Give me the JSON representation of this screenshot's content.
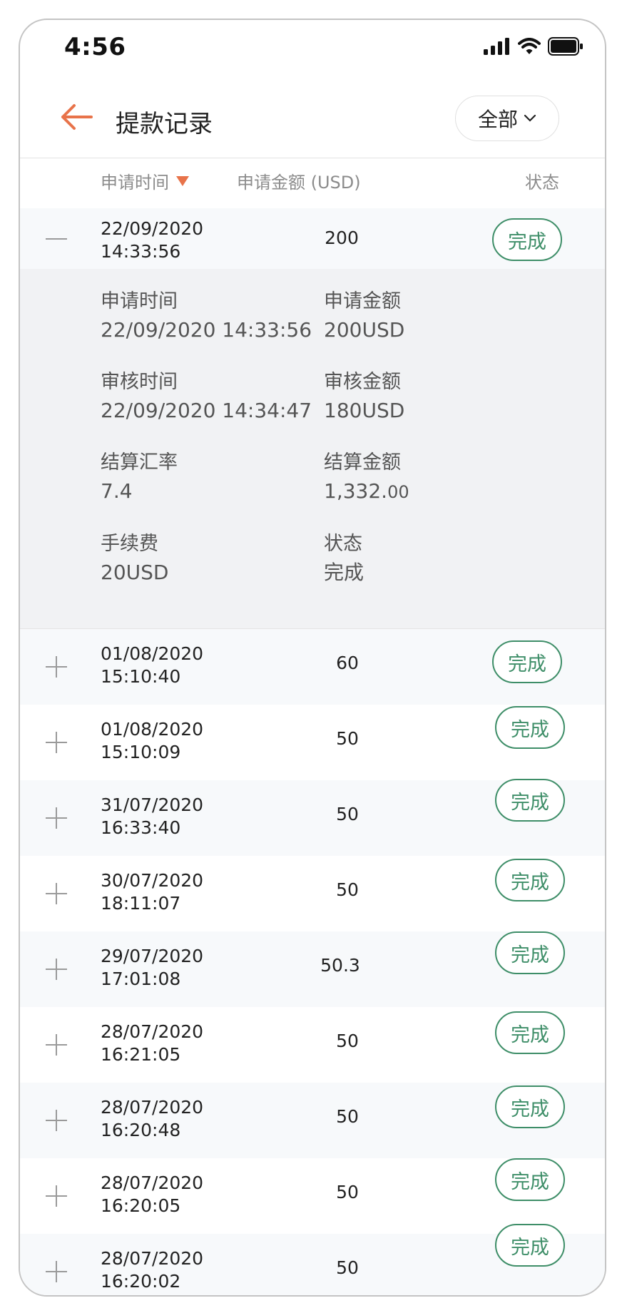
{
  "status_bar": {
    "time": "4:56"
  },
  "header": {
    "title": "提款记录",
    "filter_label": "全部"
  },
  "columns": {
    "time": "申请时间",
    "amount": "申请金额 (USD)",
    "status": "状态"
  },
  "expanded_row": {
    "date": "22/09/2020",
    "time": "14:33:56",
    "amount": "200",
    "status": "完成",
    "details": {
      "apply_time_label": "申请时间",
      "apply_time_value": "22/09/2020 14:33:56",
      "apply_amount_label": "申请金额",
      "apply_amount_value": "200USD",
      "review_time_label": "审核时间",
      "review_time_value": "22/09/2020 14:34:47",
      "review_amount_label": "审核金额",
      "review_amount_value": "180USD",
      "rate_label": "结算汇率",
      "rate_value": "7.4",
      "settle_amount_label": "结算金额",
      "settle_amount_main": "1,332.",
      "settle_amount_decimal": "00",
      "fee_label": "手续费",
      "fee_value": "20USD",
      "status_label": "状态",
      "status_value": "完成"
    }
  },
  "rows": [
    {
      "date": "01/08/2020",
      "time": "15:10:40",
      "amount": "60",
      "status": "完成"
    },
    {
      "date": "01/08/2020",
      "time": "15:10:09",
      "amount": "50",
      "status": "完成"
    },
    {
      "date": "31/07/2020",
      "time": "16:33:40",
      "amount": "50",
      "status": "完成"
    },
    {
      "date": "30/07/2020",
      "time": "18:11:07",
      "amount": "50",
      "status": "完成"
    },
    {
      "date": "29/07/2020",
      "time": "17:01:08",
      "amount": "50.3",
      "status": "完成"
    },
    {
      "date": "28/07/2020",
      "time": "16:21:05",
      "amount": "50",
      "status": "完成"
    },
    {
      "date": "28/07/2020",
      "time": "16:20:48",
      "amount": "50",
      "status": "完成"
    },
    {
      "date": "28/07/2020",
      "time": "16:20:05",
      "amount": "50",
      "status": "完成"
    },
    {
      "date": "28/07/2020",
      "time": "16:20:02",
      "amount": "50",
      "status": "完成"
    }
  ],
  "colors": {
    "accent": "#e8734a",
    "status_green": "#3e8e68"
  }
}
